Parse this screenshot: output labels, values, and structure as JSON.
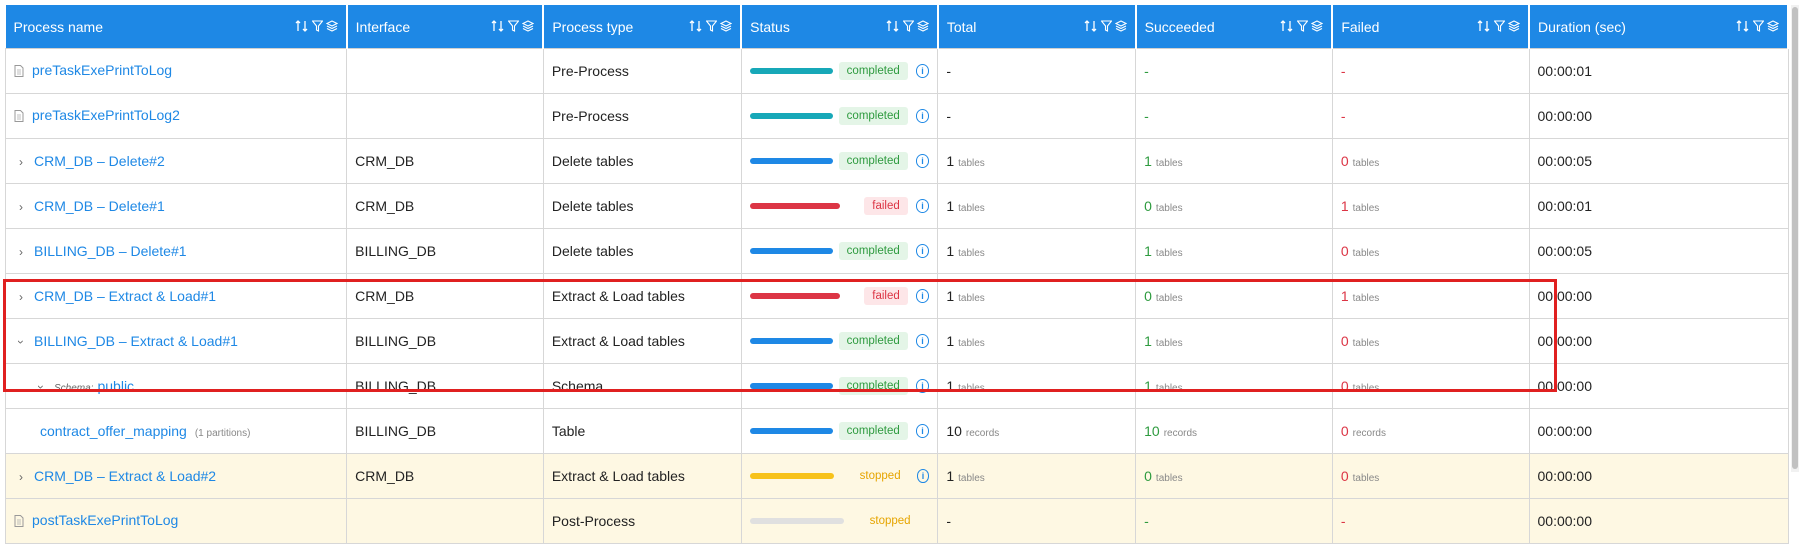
{
  "columns": [
    {
      "label": "Process name"
    },
    {
      "label": "Interface"
    },
    {
      "label": "Process type"
    },
    {
      "label": "Status"
    },
    {
      "label": "Total"
    },
    {
      "label": "Succeeded"
    },
    {
      "label": "Failed"
    },
    {
      "label": "Duration (sec)"
    }
  ],
  "schema_label": "Schema:",
  "rows": [
    {
      "name": "preTaskExePrintToLog",
      "icon": "file-icon",
      "interface": "",
      "type": "Pre-Process",
      "status": "completed",
      "bar": "teal",
      "total": "-",
      "total_unit": "",
      "succeeded": "-",
      "succeeded_unit": "",
      "failed": "-",
      "failed_unit": "",
      "duration": "00:00:01"
    },
    {
      "name": "preTaskExePrintToLog2",
      "icon": "file-icon",
      "interface": "",
      "type": "Pre-Process",
      "status": "completed",
      "bar": "teal",
      "total": "-",
      "total_unit": "",
      "succeeded": "-",
      "succeeded_unit": "",
      "failed": "-",
      "failed_unit": "",
      "duration": "00:00:00"
    },
    {
      "name": "CRM_DB – Delete#2",
      "icon": "chevron-right-icon",
      "interface": "CRM_DB",
      "type": "Delete tables",
      "status": "completed",
      "bar": "blue",
      "total": "1",
      "total_unit": "tables",
      "succeeded": "1",
      "succeeded_unit": "tables",
      "failed": "0",
      "failed_unit": "tables",
      "duration": "00:00:05"
    },
    {
      "name": "CRM_DB – Delete#1",
      "icon": "chevron-right-icon",
      "interface": "CRM_DB",
      "type": "Delete tables",
      "status": "failed",
      "bar": "red",
      "total": "1",
      "total_unit": "tables",
      "succeeded": "0",
      "succeeded_unit": "tables",
      "failed": "1",
      "failed_unit": "tables",
      "duration": "00:00:01"
    },
    {
      "name": "BILLING_DB – Delete#1",
      "icon": "chevron-right-icon",
      "interface": "BILLING_DB",
      "type": "Delete tables",
      "status": "completed",
      "bar": "blue",
      "total": "1",
      "total_unit": "tables",
      "succeeded": "1",
      "succeeded_unit": "tables",
      "failed": "0",
      "failed_unit": "tables",
      "duration": "00:00:05"
    },
    {
      "name": "CRM_DB – Extract & Load#1",
      "icon": "chevron-right-icon",
      "interface": "CRM_DB",
      "type": "Extract & Load tables",
      "status": "failed",
      "bar": "red",
      "total": "1",
      "total_unit": "tables",
      "succeeded": "0",
      "succeeded_unit": "tables",
      "failed": "1",
      "failed_unit": "tables",
      "duration": "00:00:00"
    },
    {
      "name": "BILLING_DB – Extract & Load#1",
      "icon": "chevron-down-icon",
      "interface": "BILLING_DB",
      "type": "Extract & Load tables",
      "status": "completed",
      "bar": "blue",
      "total": "1",
      "total_unit": "tables",
      "succeeded": "1",
      "succeeded_unit": "tables",
      "failed": "0",
      "failed_unit": "tables",
      "duration": "00:00:00"
    },
    {
      "name": "public",
      "icon": "chevron-down-icon",
      "interface": "BILLING_DB",
      "type": "Schema",
      "status": "completed",
      "bar": "blue",
      "total": "1",
      "total_unit": "tables",
      "succeeded": "1",
      "succeeded_unit": "tables",
      "failed": "0",
      "failed_unit": "tables",
      "duration": "00:00:00"
    },
    {
      "name": "contract_offer_mapping",
      "note": "(1 partitions)",
      "interface": "BILLING_DB",
      "type": "Table",
      "status": "completed",
      "bar": "blue",
      "total": "10",
      "total_unit": "records",
      "succeeded": "10",
      "succeeded_unit": "records",
      "failed": "0",
      "failed_unit": "records",
      "duration": "00:00:00"
    },
    {
      "name": "CRM_DB – Extract & Load#2",
      "icon": "chevron-right-icon",
      "interface": "CRM_DB",
      "type": "Extract & Load tables",
      "status": "stopped",
      "bar": "yellow",
      "total": "1",
      "total_unit": "tables",
      "succeeded": "0",
      "succeeded_unit": "tables",
      "failed": "0",
      "failed_unit": "tables",
      "duration": "00:00:00"
    },
    {
      "name": "postTaskExePrintToLog",
      "icon": "file-icon",
      "interface": "",
      "type": "Post-Process",
      "status": "stopped",
      "bar": "gray",
      "total": "-",
      "total_unit": "",
      "succeeded": "-",
      "succeeded_unit": "",
      "failed": "-",
      "failed_unit": "",
      "duration": "00:00:00"
    }
  ]
}
